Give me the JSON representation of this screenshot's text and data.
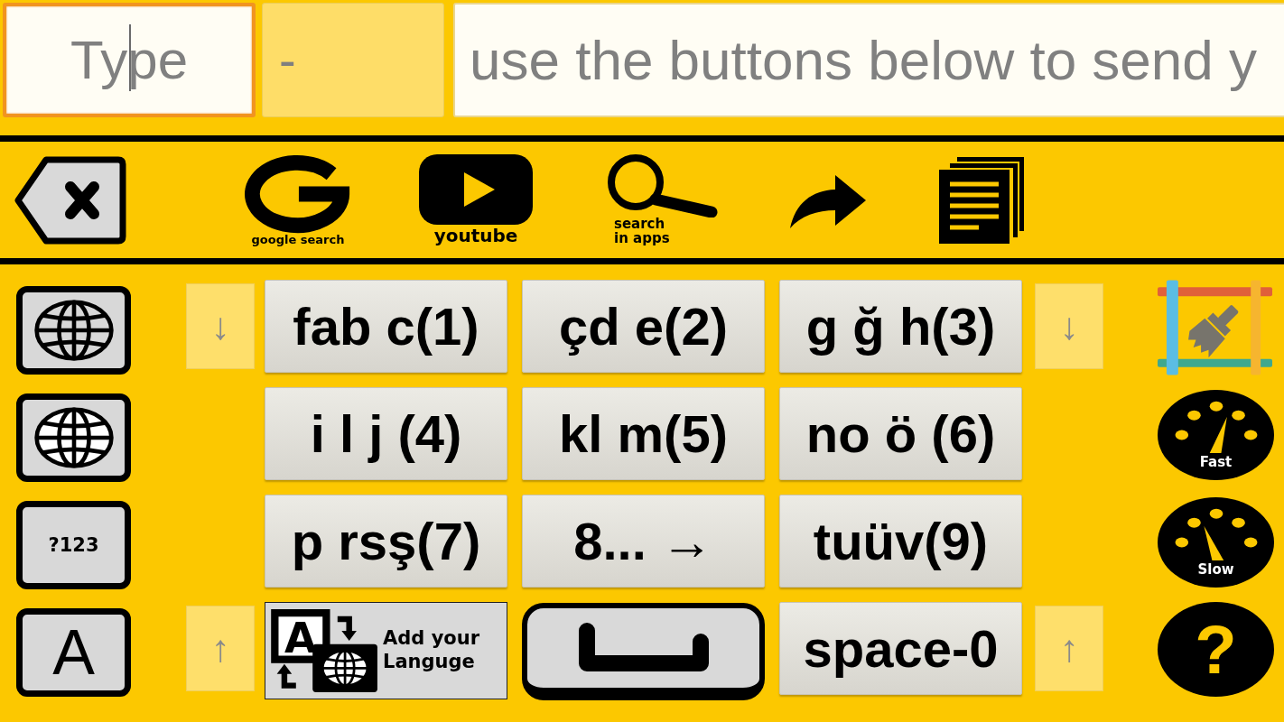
{
  "input_bar": [
    {
      "kind": "input",
      "placeholder": "Type",
      "focused": true
    },
    {
      "kind": "display",
      "value": "-"
    },
    {
      "kind": "input",
      "placeholder": "use the buttons below to send y",
      "focused": false
    }
  ],
  "toolbar": [
    {
      "kind": "backspace"
    },
    {
      "kind": "google",
      "label": "google search"
    },
    {
      "kind": "youtube",
      "label": "youtube"
    },
    {
      "kind": "search",
      "label": "search in apps"
    },
    {
      "kind": "share"
    },
    {
      "kind": "copy"
    }
  ],
  "keyboard_rows": [
    {
      "side_key": {
        "kind": "globe"
      },
      "arrow_left": "↓",
      "keys": [
        {
          "kind": "letters",
          "label": "fab c(1)"
        },
        {
          "kind": "letters",
          "label": "çd e(2)"
        },
        {
          "kind": "letters",
          "label": "g ğ h(3)"
        }
      ],
      "arrow_right": "↓",
      "tool": {
        "kind": "brush"
      }
    },
    {
      "side_key": {
        "kind": "globe_solid"
      },
      "keys": [
        {
          "kind": "letters",
          "label": "i l j (4)"
        },
        {
          "kind": "letters",
          "label": "kl m(5)"
        },
        {
          "kind": "letters",
          "label": "no ö (6)"
        }
      ],
      "tool": {
        "kind": "gauge_fast",
        "label": "Fast"
      }
    },
    {
      "side_key": {
        "kind": "symbols",
        "label": "?123"
      },
      "keys": [
        {
          "kind": "letters",
          "label": "p rsş(7)"
        },
        {
          "kind": "letters",
          "label": "8... →"
        },
        {
          "kind": "letters",
          "label": "tuüv(9)"
        }
      ],
      "tool": {
        "kind": "gauge_slow",
        "label": "Slow"
      }
    },
    {
      "side_key": {
        "kind": "letter",
        "label": "A"
      },
      "arrow_left": "↑",
      "keys": [
        {
          "kind": "add_language",
          "icon_letter": "A",
          "label": "Add your Languge"
        },
        {
          "kind": "enter"
        },
        {
          "kind": "letters",
          "label": "space-0"
        }
      ],
      "arrow_right": "↑",
      "tool": {
        "kind": "help",
        "label": "?"
      }
    }
  ]
}
